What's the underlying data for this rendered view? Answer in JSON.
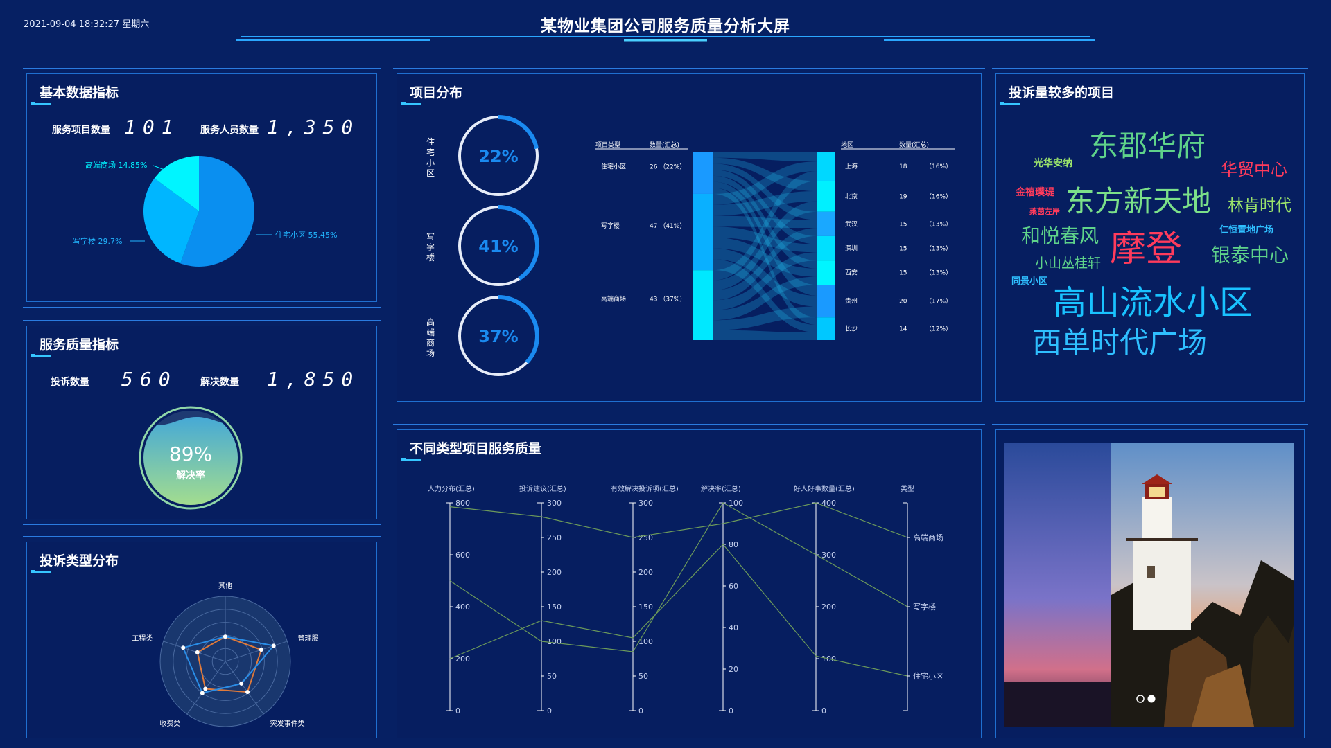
{
  "header": {
    "datetime": "2021-09-04 18:32:27 星期六",
    "title": "某物业集团公司服务质量分析大屏"
  },
  "basic": {
    "title": "基本数据指标",
    "project_count_label": "服务项目数量",
    "project_count_value": "101",
    "staff_count_label": "服务人员数量",
    "staff_count_value": "1,350",
    "pie_labels": [
      "高端商场 14.85%",
      "写字楼 29.7%",
      "住宅小区 55.45%"
    ],
    "pie_values": [
      14.85,
      29.7,
      55.45
    ],
    "pie_colors": [
      "#00f5ff",
      "#00b6ff",
      "#0a8ff0"
    ]
  },
  "quality": {
    "title": "服务质量指标",
    "complaint_label": "投诉数量",
    "complaint_value": "560",
    "resolved_label": "解决数量",
    "resolved_value": "1,850",
    "rate": "89%",
    "rate_label": "解决率",
    "rate_fraction": 0.89
  },
  "complaint_types": {
    "title": "投诉类型分布",
    "axes": [
      "其他",
      "管理服务类",
      "突发事件类",
      "收费类",
      "工程类"
    ]
  },
  "distribution": {
    "title": "项目分布",
    "rings": [
      {
        "label": "住宅小区",
        "pct": "22%",
        "fraction": 0.22
      },
      {
        "label": "写字楼",
        "pct": "41%",
        "fraction": 0.41
      },
      {
        "label": "高端商场",
        "pct": "37%",
        "fraction": 0.37
      }
    ],
    "left_headers": [
      "项目类型",
      "数量(汇总)"
    ],
    "left_rows": [
      {
        "name": "住宅小区",
        "value": "26 （22%）"
      },
      {
        "name": "写字楼",
        "value": "47 （41%）"
      },
      {
        "name": "高端商场",
        "value": "43 （37%）"
      }
    ],
    "right_headers": [
      "地区",
      "数量(汇总)"
    ],
    "right_rows": [
      {
        "name": "上海",
        "value": "18",
        "pct": "（16%）"
      },
      {
        "name": "北京",
        "value": "19",
        "pct": "（16%）"
      },
      {
        "name": "武汉",
        "value": "15",
        "pct": "（13%）"
      },
      {
        "name": "深圳",
        "value": "15",
        "pct": "（13%）"
      },
      {
        "name": "西安",
        "value": "15",
        "pct": "（13%）"
      },
      {
        "name": "贵州",
        "value": "20",
        "pct": "（17%）"
      },
      {
        "name": "长沙",
        "value": "14",
        "pct": "（12%）"
      }
    ]
  },
  "wordcloud": {
    "title": "投诉量较多的项目",
    "words": [
      {
        "text": "东郡华府",
        "color": "#5fd38a"
      },
      {
        "text": "光华安纳",
        "color": "#9be36b"
      },
      {
        "text": "华贸中心",
        "color": "#ff3b5c"
      },
      {
        "text": "金禧璞瑅",
        "color": "#ff3b5c"
      },
      {
        "text": "东方新天地",
        "color": "#7be089"
      },
      {
        "text": "莱茵左岸",
        "color": "#ff3b5c"
      },
      {
        "text": "林肯时代",
        "color": "#9be36b"
      },
      {
        "text": "仁恒置地广场",
        "color": "#2fbfff"
      },
      {
        "text": "和悦春风",
        "color": "#5fd38a"
      },
      {
        "text": "摩登",
        "color": "#ff3b5c"
      },
      {
        "text": "银泰中心",
        "color": "#5fd38a"
      },
      {
        "text": "小山丛桂轩",
        "color": "#5fd38a"
      },
      {
        "text": "同景小区",
        "color": "#2fbfff"
      },
      {
        "text": "高山流水小区",
        "color": "#19c2ff"
      },
      {
        "text": "西单时代广场",
        "color": "#2fbfff"
      }
    ]
  },
  "parallel": {
    "title": "不同类型项目服务质量",
    "axis_names": [
      "人力分布(汇总)",
      "投诉建议(汇总)",
      "有效解决投诉项(汇总)",
      "解决率(汇总)",
      "好人好事数量(汇总)",
      "类型"
    ],
    "axis_ticks": [
      [
        "0",
        "200",
        "400",
        "600",
        "800"
      ],
      [
        "0",
        "50",
        "100",
        "150",
        "200",
        "250",
        "300"
      ],
      [
        "0",
        "50",
        "100",
        "150",
        "200",
        "250",
        "300"
      ],
      [
        "0",
        "20",
        "40",
        "60",
        "80",
        "100"
      ],
      [
        "0",
        "100",
        "200",
        "300",
        "400"
      ]
    ],
    "categories": [
      "高端商场",
      "写字楼",
      "住宅小区"
    ]
  },
  "carousel": {
    "image": "lighthouse-photo"
  }
}
